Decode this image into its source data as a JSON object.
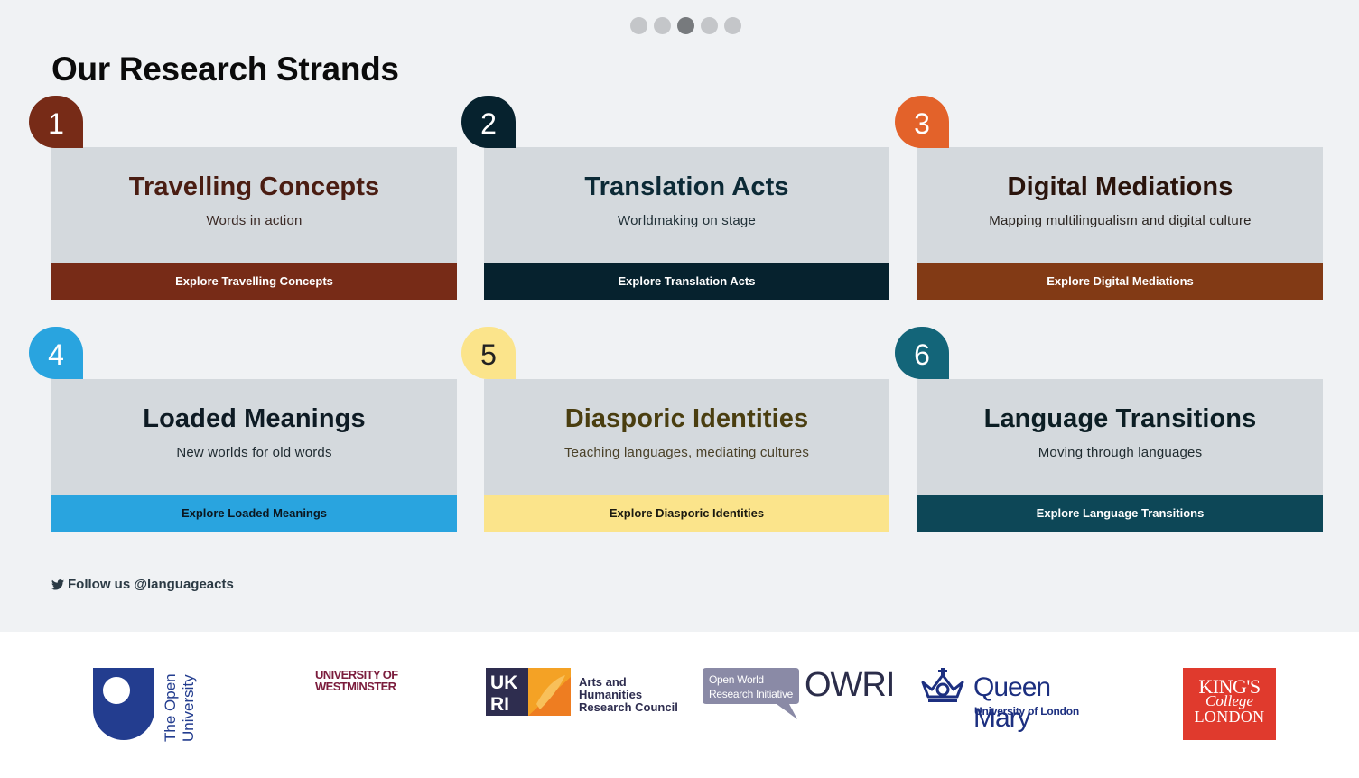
{
  "carousel": {
    "count": 5,
    "active_index": 2
  },
  "page_title": "Our Research Strands",
  "strands": [
    {
      "number": "1",
      "title": "Travelling Concepts",
      "subtitle": "Words in action",
      "button_label": "Explore Travelling Concepts",
      "accent": "#772b17",
      "title_color": "#4a1d12",
      "sub_color": "#3b2a26",
      "button_text_color": "#ffffff",
      "badge_text_color": "#ffffff"
    },
    {
      "number": "2",
      "title": "Translation Acts",
      "subtitle": "Worldmaking on stage",
      "button_label": "Explore Translation Acts",
      "accent": "#06222e",
      "title_color": "#0c2a36",
      "sub_color": "#1f2f36",
      "button_text_color": "#ffffff",
      "badge_text_color": "#ffffff"
    },
    {
      "number": "3",
      "title": "Digital Mediations",
      "subtitle": "Mapping multilingualism and digital culture",
      "button_label": "Explore Digital Mediations",
      "accent": "#823a15",
      "badge_color": "#e3622a",
      "title_color": "#2a140c",
      "sub_color": "#2a2420",
      "button_text_color": "#ffffff",
      "badge_text_color": "#ffffff"
    },
    {
      "number": "4",
      "title": "Loaded Meanings",
      "subtitle": "New worlds for old words",
      "button_label": "Explore Loaded Meanings",
      "accent": "#29a4df",
      "title_color": "#0e1b24",
      "sub_color": "#1e2a30",
      "button_text_color": "#0b1720",
      "badge_text_color": "#ffffff"
    },
    {
      "number": "5",
      "title": "Diasporic Identities",
      "subtitle": "Teaching languages, mediating cultures",
      "button_label": "Explore Diasporic Identities",
      "accent": "#fbe48b",
      "title_color": "#4a3e10",
      "sub_color": "#4a4128",
      "button_text_color": "#1b1a10",
      "badge_text_color": "#222222"
    },
    {
      "number": "6",
      "title": "Language Transitions",
      "subtitle": "Moving through languages",
      "button_label": "Explore Language Transitions",
      "accent": "#0d4757",
      "badge_color": "#136579",
      "title_color": "#0c1e24",
      "sub_color": "#1e2a2e",
      "button_text_color": "#ffffff",
      "badge_text_color": "#ffffff"
    }
  ],
  "follow": {
    "text": "Follow us @languageacts",
    "icon": "twitter-icon"
  },
  "partners": {
    "open_university": {
      "line1": "The Open",
      "line2": "University"
    },
    "westminster": {
      "line1": "UNIVERSITY OF",
      "line2": "WESTMINSTER"
    },
    "ukri": {
      "mark": "UK RI",
      "line1": "Arts and",
      "line2": "Humanities",
      "line3": "Research Council"
    },
    "owri": {
      "bubble_line1": "Open World",
      "bubble_line2": "Research Initiative",
      "name": "OWRI"
    },
    "queen_mary": {
      "name": "Queen Mary",
      "sub": "University of London"
    },
    "kings": {
      "line1": "KING'S",
      "line2": "College",
      "line3": "LONDON"
    }
  }
}
